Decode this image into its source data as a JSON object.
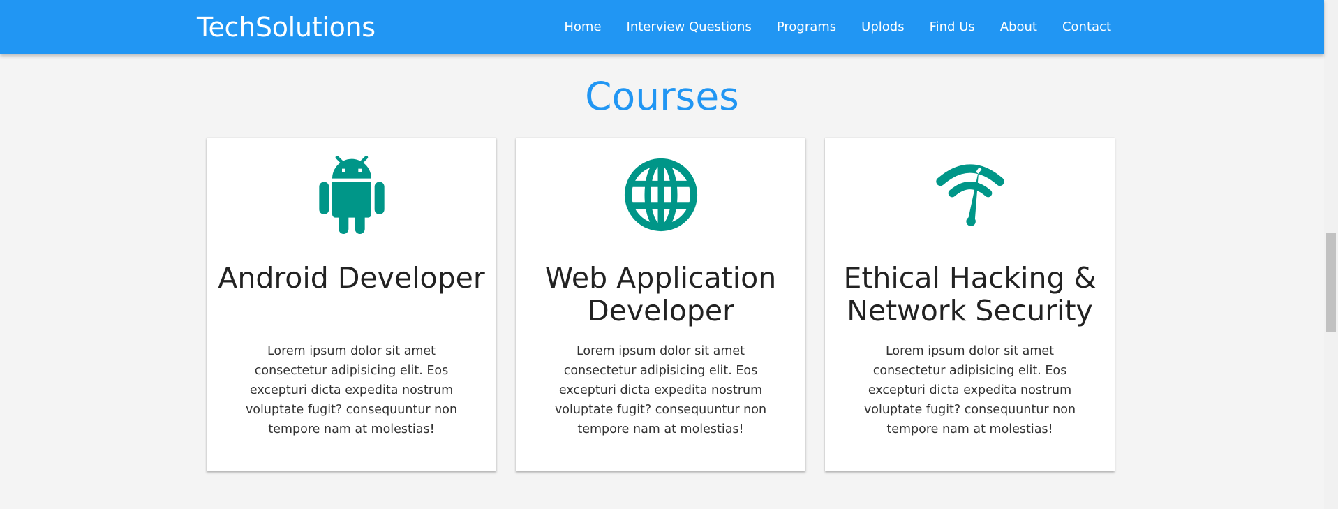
{
  "header": {
    "brand": "TechSolutions",
    "nav": [
      "Home",
      "Interview Questions",
      "Programs",
      "Uplods",
      "Find Us",
      "About",
      "Contact"
    ]
  },
  "main": {
    "title": "Courses",
    "cards": [
      {
        "icon": "android-icon",
        "title": "Android Developer",
        "text": "Lorem ipsum dolor sit amet consectetur adipisicing elit. Eos excepturi dicta expedita nostrum voluptate fugit? consequuntur non tempore nam at molestias!"
      },
      {
        "icon": "globe-icon",
        "title": "Web Application Developer",
        "text": "Lorem ipsum dolor sit amet consectetur adipisicing elit. Eos excepturi dicta expedita nostrum voluptate fugit? consequuntur non tempore nam at molestias!"
      },
      {
        "icon": "network-check-icon",
        "title": "Ethical Hacking & Network Security",
        "text": "Lorem ipsum dolor sit amet consectetur adipisicing elit. Eos excepturi dicta expedita nostrum voluptate fugit? consequuntur non tempore nam at molestias!"
      }
    ]
  },
  "colors": {
    "navbar": "#2196f3",
    "title": "#2196f3",
    "icon": "#009688",
    "background": "#f4f4f4"
  }
}
